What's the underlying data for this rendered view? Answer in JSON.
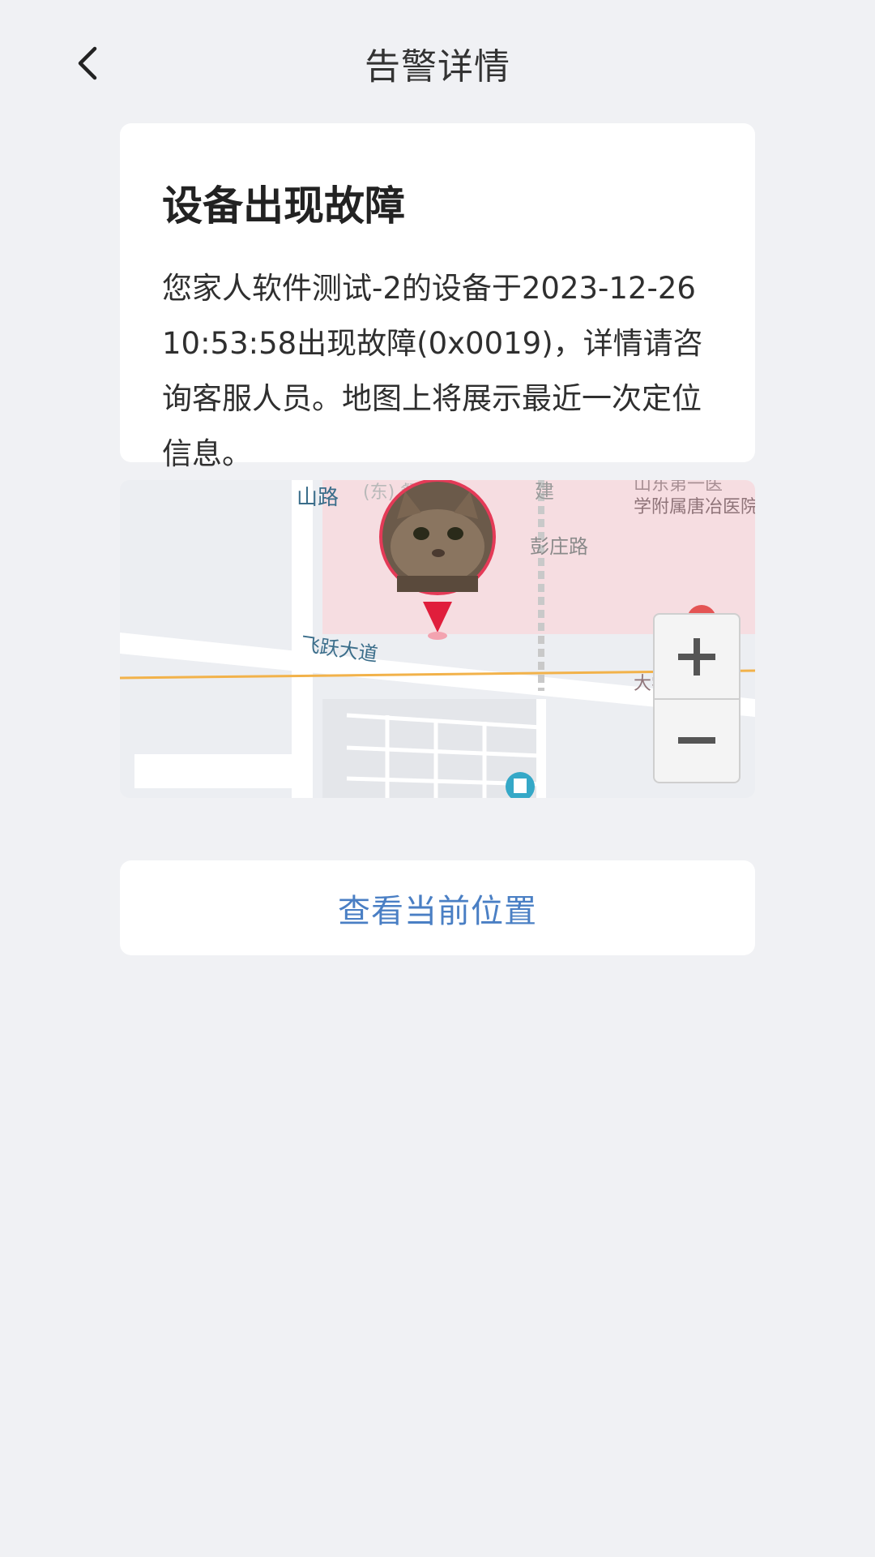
{
  "header": {
    "title": "告警详情",
    "back_icon": "chevron-left-icon"
  },
  "alert": {
    "title": "设备出现故障",
    "message": "您家人软件测试-2的设备于2023-12-26 10:53:58出现故障(0x0019)，详情请咨询客服人员。地图上将展示最近一次定位信息。"
  },
  "map": {
    "labels": {
      "road_shan": "山路",
      "road_feiyue": "飞跃大道",
      "road_pengzhuang": "彭庄路",
      "road_jian": "建",
      "hospital_residence": "学附属唐冶医院住院楼",
      "hospital_intl": "大学国际医院",
      "faded_top": "山东第一医",
      "faded_top_street": "(东)  餐街"
    },
    "zoom_in_icon": "plus-icon",
    "zoom_out_icon": "minus-icon",
    "marker_icon": "location-pin-icon",
    "avatar": "cat-avatar"
  },
  "actions": {
    "view_location": "查看当前位置"
  }
}
